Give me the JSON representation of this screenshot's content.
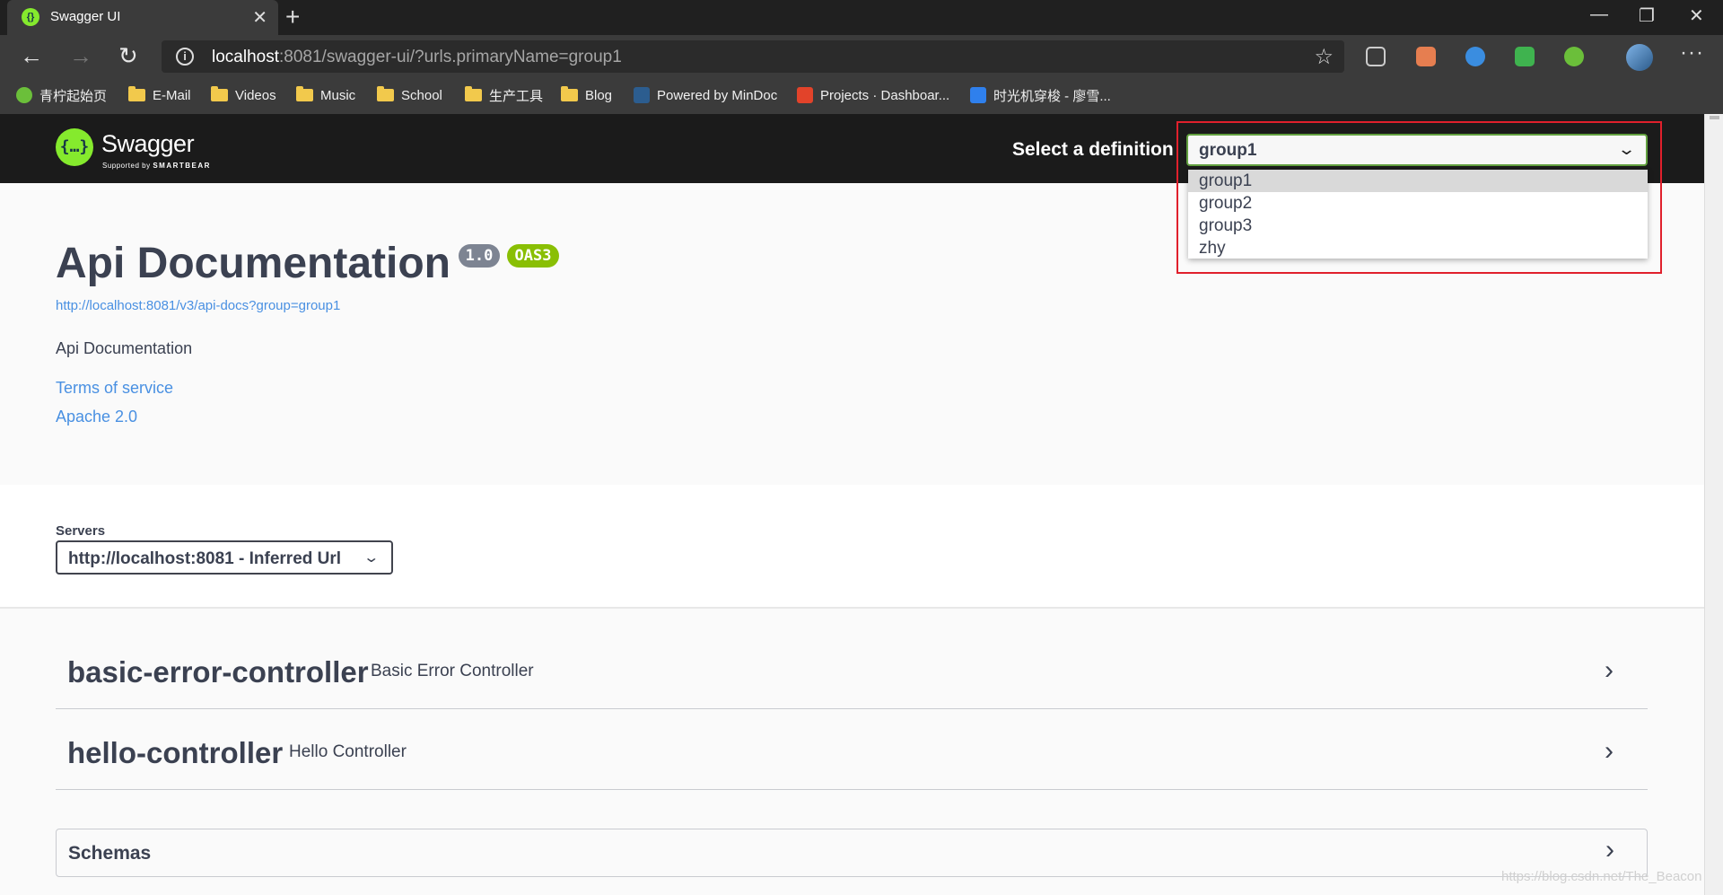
{
  "browser": {
    "tab_title": "Swagger UI",
    "url_host": "localhost",
    "url_rest": ":8081/swagger-ui/?urls.primaryName=group1",
    "bookmarks": [
      "青柠起始页",
      "E-Mail",
      "Videos",
      "Music",
      "School",
      "生产工具",
      "Blog",
      "Powered by MinDoc",
      "Projects · Dashboar...",
      "时光机穿梭 - 廖雪..."
    ]
  },
  "topbar": {
    "logo_text": "Swagger",
    "logo_sub_prefix": "Supported by",
    "logo_sub_brand": "SMARTBEAR",
    "select_label": "Select a definition",
    "selected_definition": "group1",
    "definitions": [
      "group1",
      "group2",
      "group3",
      "zhy"
    ]
  },
  "info": {
    "title": "Api Documentation",
    "version": "1.0",
    "oas": "OAS3",
    "url": "http://localhost:8081/v3/api-docs?group=group1",
    "description": "Api Documentation",
    "terms": "Terms of service",
    "license": "Apache 2.0"
  },
  "servers": {
    "label": "Servers",
    "selected": "http://localhost:8081 - Inferred Url"
  },
  "controllers": [
    {
      "name": "basic-error-controller",
      "description": "Basic Error Controller"
    },
    {
      "name": "hello-controller",
      "description": "Hello Controller"
    }
  ],
  "schemas": {
    "title": "Schemas"
  },
  "watermark": "https://blog.csdn.net/The_Beacon",
  "colors": {
    "accent": "#85ea2d",
    "link": "#4990e2",
    "highlight": "#e0202c",
    "topbar": "#1b1b1b"
  }
}
